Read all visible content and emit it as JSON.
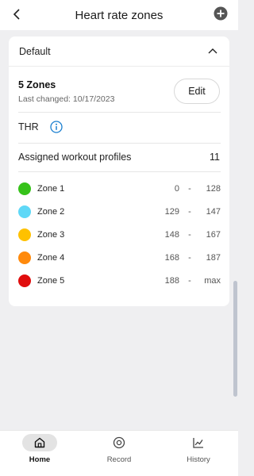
{
  "header": {
    "title": "Heart rate zones",
    "back_icon": "back-arrow-icon",
    "add_icon": "plus-circle-icon"
  },
  "card": {
    "section_label": "Default",
    "zones_count": "5 Zones",
    "last_changed": "Last changed: 10/17/2023",
    "edit_label": "Edit",
    "thr_label": "THR",
    "profiles_label": "Assigned workout profiles",
    "profiles_count": "11",
    "zones": [
      {
        "name": "Zone 1",
        "low": "0",
        "sep": "-",
        "high": "128",
        "color": "#36c21a"
      },
      {
        "name": "Zone 2",
        "low": "129",
        "sep": "-",
        "high": "147",
        "color": "#5fd8f7"
      },
      {
        "name": "Zone 3",
        "low": "148",
        "sep": "-",
        "high": "167",
        "color": "#ffc100"
      },
      {
        "name": "Zone 4",
        "low": "168",
        "sep": "-",
        "high": "187",
        "color": "#ff8a0c"
      },
      {
        "name": "Zone 5",
        "low": "188",
        "sep": "-",
        "high": "max",
        "color": "#e00d0d"
      }
    ]
  },
  "nav": {
    "items": [
      {
        "label": "Home",
        "icon": "home-icon",
        "active": true
      },
      {
        "label": "Record",
        "icon": "record-icon",
        "active": false
      },
      {
        "label": "History",
        "icon": "history-chart-icon",
        "active": false
      }
    ]
  },
  "colors": {
    "accent_info": "#1a7fd0",
    "background": "#efeff1"
  }
}
